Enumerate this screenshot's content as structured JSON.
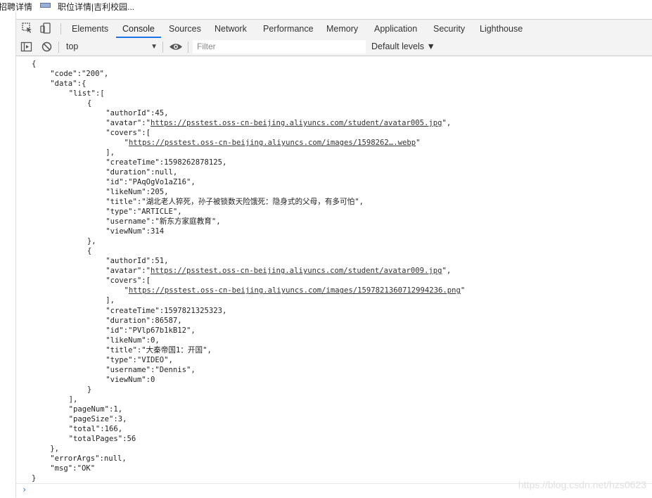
{
  "browser_tabs": [
    {
      "title": "招聘详情"
    },
    {
      "title": "职位详情|吉利校园..."
    }
  ],
  "devtools": {
    "tabs": [
      "Elements",
      "Console",
      "Sources",
      "Network",
      "Performance",
      "Memory",
      "Application",
      "Security",
      "Lighthouse"
    ],
    "active_tab": "Console"
  },
  "console_toolbar": {
    "context": "top",
    "filter_placeholder": "Filter",
    "levels": "Default levels ▼"
  },
  "console_lines": [
    {
      "indent": 0,
      "text": "{"
    },
    {
      "indent": 1,
      "text": "\"code\":\"200\","
    },
    {
      "indent": 1,
      "text": "\"data\":{"
    },
    {
      "indent": 2,
      "text": "\"list\":["
    },
    {
      "indent": 3,
      "text": "{"
    },
    {
      "indent": 4,
      "text": "\"authorId\":45,"
    },
    {
      "indent": 4,
      "pre": "\"avatar\":\"",
      "link": "https://psstest.oss-cn-beijing.aliyuncs.com/student/avatar005.jpg",
      "post": "\","
    },
    {
      "indent": 4,
      "text": "\"covers\":["
    },
    {
      "indent": 5,
      "pre": "\"",
      "link": "https://psstest.oss-cn-beijing.aliyuncs.com/images/1598262….webp",
      "post": "\""
    },
    {
      "indent": 4,
      "text": "],"
    },
    {
      "indent": 4,
      "text": "\"createTime\":1598262878125,"
    },
    {
      "indent": 4,
      "text": "\"duration\":null,"
    },
    {
      "indent": 4,
      "text": "\"id\":\"PAqOgVo1aZ16\","
    },
    {
      "indent": 4,
      "text": "\"likeNum\":205,"
    },
    {
      "indent": 4,
      "text": "\"title\":\"湖北老人猝死，孙子被锁数天险饿死：隐身式的父母，有多可怕\","
    },
    {
      "indent": 4,
      "text": "\"type\":\"ARTICLE\","
    },
    {
      "indent": 4,
      "text": "\"username\":\"新东方家庭教育\","
    },
    {
      "indent": 4,
      "text": "\"viewNum\":314"
    },
    {
      "indent": 3,
      "text": "},"
    },
    {
      "indent": 3,
      "text": "{"
    },
    {
      "indent": 4,
      "text": "\"authorId\":51,"
    },
    {
      "indent": 4,
      "pre": "\"avatar\":\"",
      "link": "https://psstest.oss-cn-beijing.aliyuncs.com/student/avatar009.jpg",
      "post": "\","
    },
    {
      "indent": 4,
      "text": "\"covers\":["
    },
    {
      "indent": 5,
      "pre": "\"",
      "link": "https://psstest.oss-cn-beijing.aliyuncs.com/images/1597821360712994236.png",
      "post": "\""
    },
    {
      "indent": 4,
      "text": "],"
    },
    {
      "indent": 4,
      "text": "\"createTime\":1597821325323,"
    },
    {
      "indent": 4,
      "text": "\"duration\":86587,"
    },
    {
      "indent": 4,
      "text": "\"id\":\"PVlp67b1kB12\","
    },
    {
      "indent": 4,
      "text": "\"likeNum\":0,"
    },
    {
      "indent": 4,
      "text": "\"title\":\"大秦帝国1：开国\","
    },
    {
      "indent": 4,
      "text": "\"type\":\"VIDEO\","
    },
    {
      "indent": 4,
      "text": "\"username\":\"Dennis\","
    },
    {
      "indent": 4,
      "text": "\"viewNum\":0"
    },
    {
      "indent": 3,
      "text": "}"
    },
    {
      "indent": 2,
      "text": "],"
    },
    {
      "indent": 2,
      "text": "\"pageNum\":1,"
    },
    {
      "indent": 2,
      "text": "\"pageSize\":3,"
    },
    {
      "indent": 2,
      "text": "\"total\":166,"
    },
    {
      "indent": 2,
      "text": "\"totalPages\":56"
    },
    {
      "indent": 1,
      "text": "},"
    },
    {
      "indent": 1,
      "text": "\"errorArgs\":null,"
    },
    {
      "indent": 1,
      "text": "\"msg\":\"OK\""
    },
    {
      "indent": 0,
      "text": "}"
    }
  ],
  "prompt_symbol": "›",
  "watermark": "https://blog.csdn.net/hzs0623"
}
